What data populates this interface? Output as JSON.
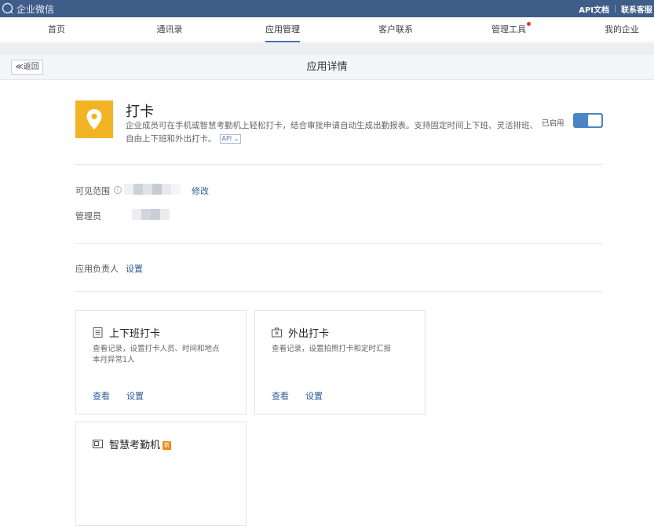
{
  "topbar": {
    "brand": "企业微信",
    "api_doc": "API文档",
    "contact_support": "联系客服"
  },
  "nav": {
    "items": [
      {
        "label": "首页"
      },
      {
        "label": "通讯录"
      },
      {
        "label": "应用管理",
        "active": true
      },
      {
        "label": "客户联系"
      },
      {
        "label": "管理工具",
        "has_dot": true
      },
      {
        "label": "我的企业"
      }
    ]
  },
  "subheader": {
    "back_label": "≪返回",
    "title": "应用详情"
  },
  "app": {
    "name": "打卡",
    "description": "企业成员可在手机或智慧考勤机上轻松打卡，结合审批申请自动生成出勤报表。支持固定时间上下班、灵活排班、自由上下班和外出打卡。",
    "api_tag": "API",
    "status_label": "已启用",
    "enabled": true,
    "icon": "location-pin-icon",
    "icon_color": "#f2b424"
  },
  "visibility": {
    "label": "可见范围",
    "edit_link": "修改"
  },
  "admin": {
    "label": "管理员"
  },
  "owner": {
    "label": "应用负责人",
    "set_link": "设置"
  },
  "cards": [
    {
      "title": "上下班打卡",
      "icon": "list-document-icon",
      "desc_line1": "查看记录，设置打卡人员、时间和地点",
      "desc_line2": "本月异常1人",
      "view": "查看",
      "settings": "设置"
    },
    {
      "title": "外出打卡",
      "icon": "briefcase-icon",
      "desc_line1": "查看记录，设置拍照打卡和定时汇报",
      "desc_line2": "",
      "view": "查看",
      "settings": "设置"
    },
    {
      "title": "智慧考勤机",
      "icon": "attendance-machine-icon",
      "badge": "新"
    }
  ],
  "colors": {
    "topbar": "#3e5d88",
    "accent": "#3e6fb0",
    "link": "#2d5c9a",
    "toggle_on": "#4a86c6"
  }
}
